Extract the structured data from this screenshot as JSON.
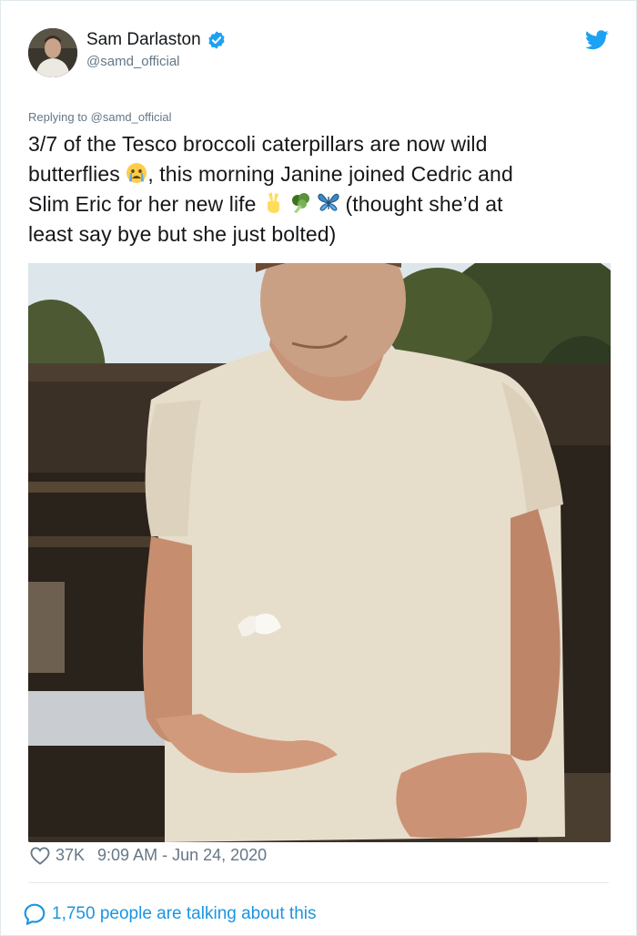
{
  "user": {
    "display_name": "Sam Darlaston",
    "handle": "@samd_official",
    "verified": true,
    "avatar_icon": "avatar"
  },
  "reply": {
    "prefix": "Replying to",
    "mention": "@samd_official"
  },
  "tweet": {
    "line1": "3/7 of the Tesco broccoli caterpillars are now wild",
    "line2a": "butterflies",
    "line2b": ", this morning Janine joined Cedric and",
    "line3a": "Slim Eric for her new life",
    "line3b": " (thought she’d at",
    "line4": "least say bye but she just bolted)",
    "emojis": [
      "crying-face-icon",
      "victory-hand-icon",
      "broccoli-icon",
      "butterfly-icon"
    ]
  },
  "media": {
    "icon": "photo-man-releasing-butterfly"
  },
  "footer": {
    "likes": "37K",
    "timestamp": "9:09 AM - Jun 24, 2020",
    "talking": "1,750 people are talking about this"
  },
  "colors": {
    "accent": "#1da1f2",
    "link": "#1b95e0",
    "muted": "#657786",
    "text": "#14171a"
  }
}
